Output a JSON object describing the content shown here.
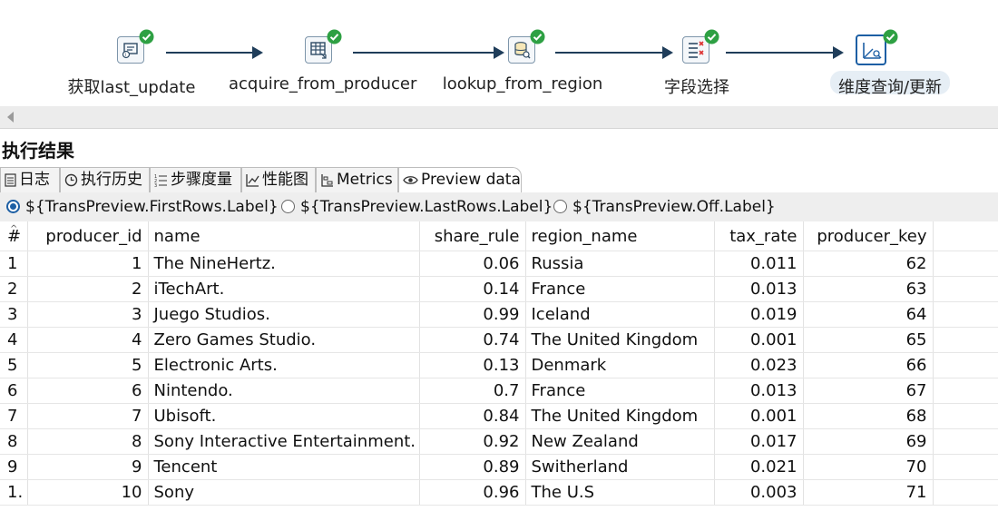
{
  "pipeline": {
    "steps": [
      {
        "label": "获取last_update",
        "icon": "table-input-icon"
      },
      {
        "label": "acquire_from_producer",
        "icon": "table-output-icon"
      },
      {
        "label": "lookup_from_region",
        "icon": "database-lookup-icon"
      },
      {
        "label": "字段选择",
        "icon": "select-values-icon"
      },
      {
        "label": "维度查询/更新",
        "icon": "dimension-lookup-icon"
      }
    ],
    "status_icon": "checkmark-icon",
    "status_color": "#2ea043",
    "accent_color": "#1d5fa4"
  },
  "results": {
    "title": "执行结果",
    "tabs": [
      {
        "label": "日志",
        "icon": "log-icon"
      },
      {
        "label": "执行历史",
        "icon": "history-icon"
      },
      {
        "label": "步骤度量",
        "icon": "step-metrics-icon"
      },
      {
        "label": "性能图",
        "icon": "performance-chart-icon"
      },
      {
        "label": "Metrics",
        "icon": "metrics-icon"
      },
      {
        "label": "Preview data",
        "icon": "eye-icon"
      }
    ],
    "active_tab": "Preview data",
    "radios": [
      {
        "label": "${TransPreview.FirstRows.Label}",
        "checked": true
      },
      {
        "label": "${TransPreview.LastRows.Label}",
        "checked": false
      },
      {
        "label": "${TransPreview.Off.Label}",
        "checked": false
      }
    ]
  },
  "table": {
    "headers": [
      "#",
      "producer_id",
      "name",
      "share_rule",
      "region_name",
      "tax_rate",
      "producer_key"
    ],
    "rows": [
      [
        "1",
        "1",
        "The NineHertz.",
        "0.06",
        "Russia",
        "0.011",
        "62"
      ],
      [
        "2",
        "2",
        "iTechArt.",
        "0.14",
        "France",
        "0.013",
        "63"
      ],
      [
        "3",
        "3",
        "Juego Studios.",
        "0.99",
        "Iceland",
        "0.019",
        "64"
      ],
      [
        "4",
        "4",
        "Zero Games Studio.",
        "0.74",
        "The United Kingdom",
        "0.001",
        "65"
      ],
      [
        "5",
        "5",
        "Electronic Arts.",
        "0.13",
        "Denmark",
        "0.023",
        "66"
      ],
      [
        "6",
        "6",
        "Nintendo.",
        "0.7",
        "France",
        "0.013",
        "67"
      ],
      [
        "7",
        "7",
        "Ubisoft.",
        "0.84",
        "The United Kingdom",
        "0.001",
        "68"
      ],
      [
        "8",
        "8",
        "Sony Interactive Entertainment.",
        "0.92",
        "New Zealand",
        "0.017",
        "69"
      ],
      [
        "9",
        "9",
        "Tencent",
        "0.89",
        "Switherland",
        "0.021",
        "70"
      ],
      [
        "1.",
        "10",
        "Sony",
        "0.96",
        "The U.S",
        "0.003",
        "71"
      ]
    ]
  }
}
